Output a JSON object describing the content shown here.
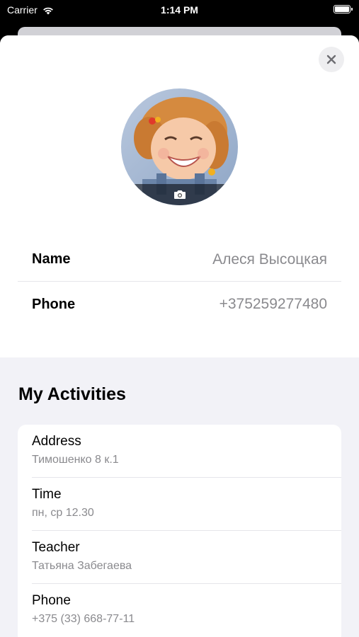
{
  "status_bar": {
    "carrier": "Carrier",
    "time": "1:14 PM"
  },
  "icons": {
    "close": "close-icon",
    "camera": "camera-icon",
    "wifi": "wifi-icon",
    "battery": "battery-icon"
  },
  "profile": {
    "name_label": "Name",
    "name_value": "Алеся Высоцкая",
    "phone_label": "Phone",
    "phone_value": "+375259277480"
  },
  "activities": {
    "title": "My Activities",
    "items": [
      {
        "label": "Address",
        "value": "Тимошенко 8 к.1"
      },
      {
        "label": "Time",
        "value": "пн, ср 12.30"
      },
      {
        "label": "Teacher",
        "value": "Татьяна Забегаева"
      },
      {
        "label": "Phone",
        "value": "+375 (33) 668-77-11"
      }
    ]
  },
  "colors": {
    "accent_gray": "#8a8a8e",
    "sheet_bg": "#f2f2f7",
    "separator": "#e5e5ea"
  }
}
